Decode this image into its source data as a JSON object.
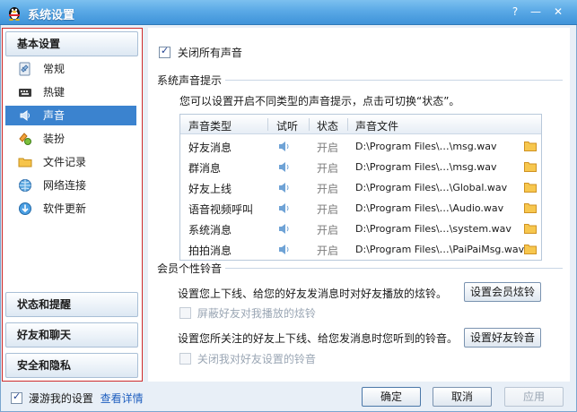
{
  "window": {
    "title": "系统设置",
    "help": "?",
    "minimize": "—",
    "close": "✕"
  },
  "sidebar": {
    "top_header": "基本设置",
    "items": [
      {
        "label": "常规",
        "icon": "general-icon",
        "active": false
      },
      {
        "label": "热键",
        "icon": "keyboard-icon",
        "active": false
      },
      {
        "label": "声音",
        "icon": "speaker-icon",
        "active": true
      },
      {
        "label": "装扮",
        "icon": "dressup-icon",
        "active": false
      },
      {
        "label": "文件记录",
        "icon": "folder-icon",
        "active": false
      },
      {
        "label": "网络连接",
        "icon": "network-icon",
        "active": false
      },
      {
        "label": "软件更新",
        "icon": "update-icon",
        "active": false
      }
    ],
    "bottom_headers": [
      "状态和提醒",
      "好友和聊天",
      "安全和隐私"
    ]
  },
  "content": {
    "mute_all": {
      "label": "关闭所有声音",
      "checked": true
    },
    "system_section": {
      "title": "系统声音提示",
      "desc": "您可以设置开启不同类型的声音提示，点击可切换“状态”。"
    },
    "table": {
      "headers": [
        "声音类型",
        "试听",
        "状态",
        "声音文件"
      ],
      "rows": [
        {
          "type": "好友消息",
          "status": "开启",
          "file": "D:\\Program Files\\…\\msg.wav"
        },
        {
          "type": "群消息",
          "status": "开启",
          "file": "D:\\Program Files\\…\\msg.wav"
        },
        {
          "type": "好友上线",
          "status": "开启",
          "file": "D:\\Program Files\\…\\Global.wav"
        },
        {
          "type": "语音视频呼叫",
          "status": "开启",
          "file": "D:\\Program Files\\…\\Audio.wav"
        },
        {
          "type": "系统消息",
          "status": "开启",
          "file": "D:\\Program Files\\…\\system.wav"
        },
        {
          "type": "拍拍消息",
          "status": "开启",
          "file": "D:\\Program Files\\…\\PaiPaiMsg.wav"
        }
      ]
    },
    "member_section": {
      "title": "会员个性铃音",
      "line1": "设置您上下线、给您的好友发消息时对好友播放的炫铃。",
      "btn1": "设置会员炫铃",
      "chk1": "屏蔽好友对我播放的炫铃",
      "line2": "设置您所关注的好友上下线、给您发消息时您听到的铃音。",
      "btn2": "设置好友铃音",
      "chk2": "关闭我对好友设置的铃音"
    }
  },
  "footer": {
    "roam_label": "漫游我的设置",
    "roam_checked": true,
    "details_link": "查看详情",
    "ok": "确定",
    "cancel": "取消",
    "apply": "应用"
  },
  "colors": {
    "titlebar": "#5aa9e6",
    "active_item": "#3b83cf",
    "sidebar_border": "#cf2b2b",
    "link": "#1f5fbf"
  }
}
